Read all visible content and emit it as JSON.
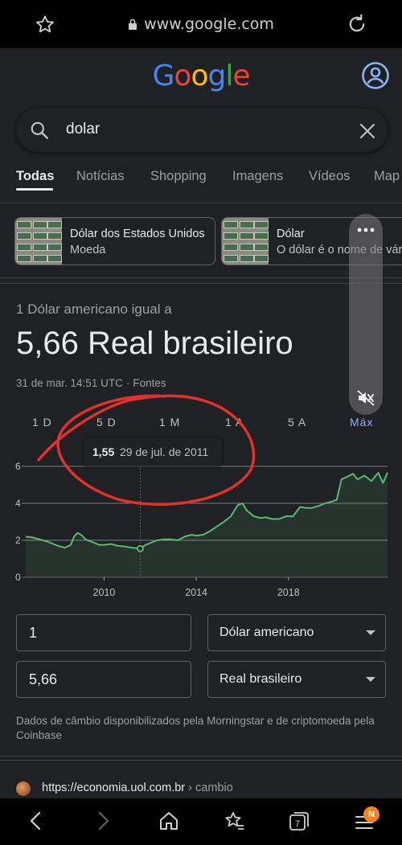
{
  "browser": {
    "url": "www.google.com"
  },
  "header": {
    "logo_letters": [
      {
        "ch": "G",
        "color": "#4285f4"
      },
      {
        "ch": "o",
        "color": "#ea4335"
      },
      {
        "ch": "o",
        "color": "#fbbc05"
      },
      {
        "ch": "g",
        "color": "#4285f4"
      },
      {
        "ch": "l",
        "color": "#34a853"
      },
      {
        "ch": "e",
        "color": "#ea4335"
      }
    ],
    "accent_color": "#8ab4f8"
  },
  "search": {
    "query": "dolar"
  },
  "tabs": [
    "Todas",
    "Notícias",
    "Shopping",
    "Imagens",
    "Vídeos",
    "Map"
  ],
  "entity_chips": [
    {
      "title": "Dólar dos Estados Unidos",
      "subtitle": "Moeda"
    },
    {
      "title": "Dólar",
      "subtitle": "O dólar é o nome de várias moedas"
    }
  ],
  "converter": {
    "label": "1 Dólar americano igual a",
    "result": "5,66 Real brasileiro",
    "timestamp": "31 de mar. 14:51 UTC",
    "sources_link": "Fontes",
    "range_options": [
      "1 D",
      "5 D",
      "1 M",
      "1 A",
      "5 A",
      "Máx"
    ],
    "selected_range": "Máx",
    "tooltip": {
      "value": "1,55",
      "date": "29 de jul. de 2011"
    },
    "amount_from": "1",
    "currency_from": "Dólar americano",
    "amount_to": "5,66",
    "currency_to": "Real brasileiro",
    "disclaimer": "Dados de câmbio disponibilizados pela Morningstar e de criptomoeda pela Coinbase"
  },
  "chart_data": {
    "type": "line",
    "title": "",
    "xlabel": "",
    "ylabel": "",
    "x_ticks": [
      2010,
      2014,
      2018
    ],
    "y_ticks": [
      0,
      2,
      4,
      6
    ],
    "xlim": [
      2006.6,
      2022.3
    ],
    "ylim": [
      0,
      6
    ],
    "grid": true,
    "series_color": "#5bb974",
    "highlight": {
      "x": 2011.57,
      "y": 1.55
    },
    "series": [
      {
        "x": [
          2006.6,
          2006.9,
          2007.2,
          2007.5,
          2007.8,
          2008.0,
          2008.3,
          2008.55,
          2008.7,
          2008.85,
          2009.0,
          2009.2,
          2009.4,
          2009.6,
          2009.8,
          2010.0,
          2010.3,
          2010.6,
          2010.9,
          2011.2,
          2011.57,
          2011.8,
          2012.0,
          2012.3,
          2012.6,
          2012.9,
          2013.2,
          2013.5,
          2013.8,
          2014.0,
          2014.3,
          2014.6,
          2014.9,
          2015.2,
          2015.5,
          2015.8,
          2016.0,
          2016.2,
          2016.5,
          2016.8,
          2017.0,
          2017.3,
          2017.6,
          2017.9,
          2018.2,
          2018.5,
          2018.8,
          2019.0,
          2019.3,
          2019.6,
          2019.9,
          2020.1,
          2020.3,
          2020.5,
          2020.8,
          2021.0,
          2021.3,
          2021.6,
          2021.9,
          2022.1,
          2022.3
        ],
        "y": [
          2.2,
          2.15,
          2.05,
          1.95,
          1.8,
          1.7,
          1.6,
          1.75,
          2.2,
          2.4,
          2.3,
          2.05,
          1.95,
          1.85,
          1.75,
          1.75,
          1.8,
          1.7,
          1.66,
          1.6,
          1.55,
          1.75,
          1.85,
          2.0,
          2.05,
          2.05,
          2.0,
          2.2,
          2.3,
          2.25,
          2.3,
          2.5,
          2.75,
          3.0,
          3.3,
          3.9,
          4.0,
          3.6,
          3.3,
          3.2,
          3.25,
          3.15,
          3.15,
          3.3,
          3.3,
          3.8,
          3.75,
          3.75,
          3.85,
          4.0,
          4.1,
          4.2,
          5.3,
          5.4,
          5.6,
          5.3,
          5.5,
          5.2,
          5.65,
          5.1,
          5.66
        ]
      }
    ]
  }
}
